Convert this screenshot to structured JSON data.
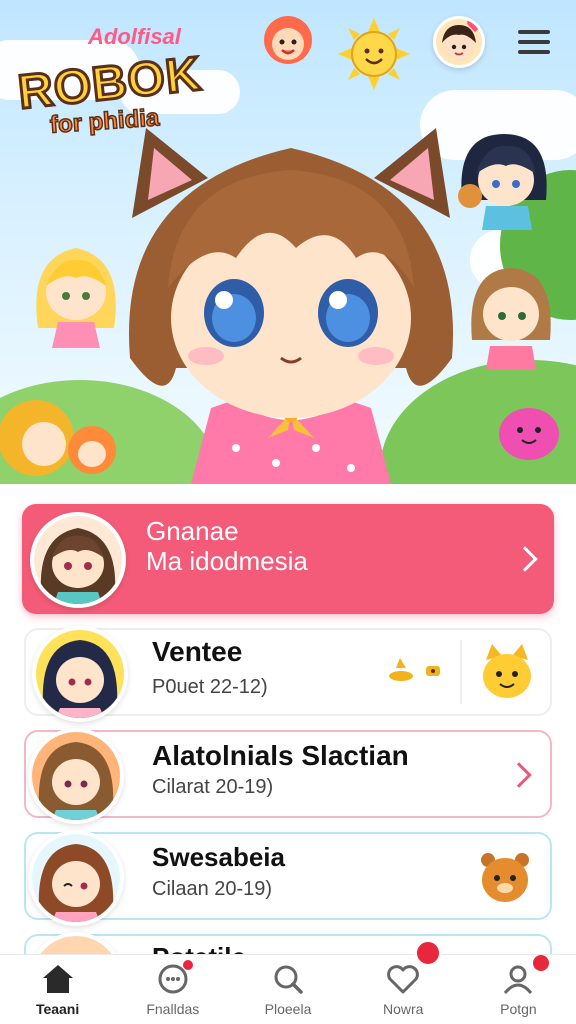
{
  "hero": {
    "logo": {
      "line1": "Adolfisal",
      "line2": "ROBOK",
      "line3": "for phidia"
    }
  },
  "featured": {
    "title": "Gnanae",
    "subtitle": "Ma idodmesia"
  },
  "items": [
    {
      "title": "Ventee",
      "subtitle": "P0uet 22-12)"
    },
    {
      "title": "Alatolnials Slactian",
      "subtitle": "Cilarat 20-19)"
    },
    {
      "title": "Swesabeia",
      "subtitle": "Cilaan 20-19)"
    },
    {
      "title": "Potetile"
    }
  ],
  "nav": [
    {
      "label": "Teaani",
      "icon": "home-icon",
      "active": true
    },
    {
      "label": "Fnalldas",
      "icon": "chat-icon",
      "active": false
    },
    {
      "label": "Ploeela",
      "icon": "search-icon",
      "active": false
    },
    {
      "label": "Nowra",
      "icon": "heart-icon",
      "active": false
    },
    {
      "label": "Potgn",
      "icon": "profile-icon",
      "active": false
    }
  ],
  "colors": {
    "accent": "#f45b78",
    "badge": "#e8263c",
    "sky": "#bfe6ff"
  }
}
